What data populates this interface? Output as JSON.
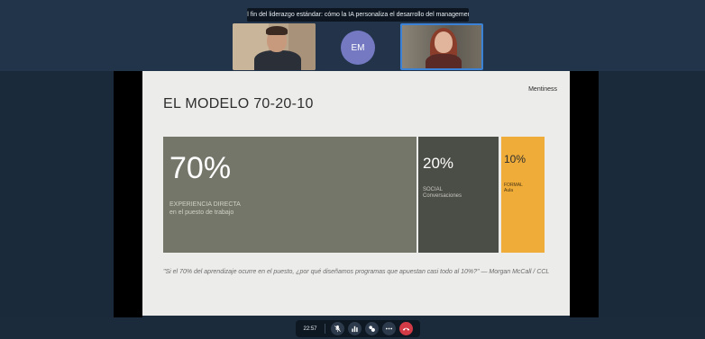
{
  "meeting": {
    "title": "El fin del liderazgo estándar: cómo la IA personaliza el desarrollo del management"
  },
  "participants": [
    {
      "kind": "video"
    },
    {
      "kind": "avatar",
      "initials": "EM",
      "color": "#7479c2"
    },
    {
      "kind": "video",
      "active_speaker": true
    }
  ],
  "slide": {
    "brand": "Mentiness",
    "title": "EL MODELO 70-20-10",
    "blocks": [
      {
        "percent": "70%",
        "category": "EXPERIENCIA DIRECTA",
        "detail": "en el puesto de trabajo",
        "color": "#747669"
      },
      {
        "percent": "20%",
        "category": "SOCIAL",
        "detail": "Conversaciones",
        "color": "#4b4d47"
      },
      {
        "percent": "10%",
        "category": "FORMAL",
        "detail": "Aula",
        "color": "#efac38"
      }
    ],
    "quote": "\"Si el 70% del aprendizaje ocurre en el puesto, ¿por qué diseñamos programas que apuestan casi todo al 10%?\"  — Morgan McCall / CCL"
  },
  "toolbar": {
    "time": "22:57",
    "buttons": [
      {
        "icon": "mic-off-icon"
      },
      {
        "icon": "stats-icon"
      },
      {
        "icon": "reactions-icon"
      },
      {
        "icon": "more-icon"
      },
      {
        "icon": "hang-up-icon",
        "color": "#d23a45"
      }
    ]
  }
}
